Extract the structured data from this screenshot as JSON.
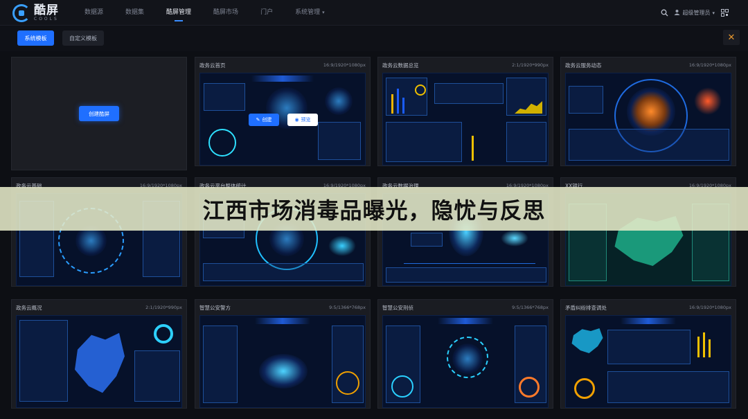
{
  "app": {
    "logo_text": "酷屏",
    "logo_sub": "COOLS"
  },
  "nav": {
    "items": [
      {
        "label": "数据源"
      },
      {
        "label": "数据集"
      },
      {
        "label": "酷屏管理"
      },
      {
        "label": "酷屏市场"
      },
      {
        "label": "门户"
      },
      {
        "label": "系统管理"
      }
    ],
    "active_index": 2
  },
  "user": {
    "name": "超级管理员"
  },
  "tabs": {
    "system": "系统模板",
    "custom": "自定义模板"
  },
  "empty_card": {
    "create_label": "创建酷屏"
  },
  "overlay": {
    "create": "创建",
    "preview": "预览"
  },
  "cards": [
    {
      "title": "政务云首页",
      "spec": "16:9/1920*1080px"
    },
    {
      "title": "政务云数据总览",
      "spec": "2:1/1920*990px"
    },
    {
      "title": "政务云服务动态",
      "spec": "16:9/1920*1080px"
    },
    {
      "title": "政务云基础",
      "spec": "16:9/1920*1080px"
    },
    {
      "title": "政务云平台整体统计",
      "spec": "16:9/1920*1080px"
    },
    {
      "title": "政务云数据治理",
      "spec": "16:9/1920*1080px"
    },
    {
      "title": "XX银行",
      "spec": "16:9/1920*1080px"
    },
    {
      "title": "政务云概况",
      "spec": "2:1/1920*990px"
    },
    {
      "title": "智慧公安警方",
      "spec": "9:5/1366*768px"
    },
    {
      "title": "智慧公安刑侦",
      "spec": "9:5/1366*768px"
    },
    {
      "title": "矛盾纠纷排查调处",
      "spec": "16:9/1920*1080px"
    }
  ],
  "banner": {
    "text": "江西市场消毒品曝光，隐忧与反思"
  },
  "colors": {
    "accent": "#1f6fff",
    "close": "#e5962e"
  }
}
